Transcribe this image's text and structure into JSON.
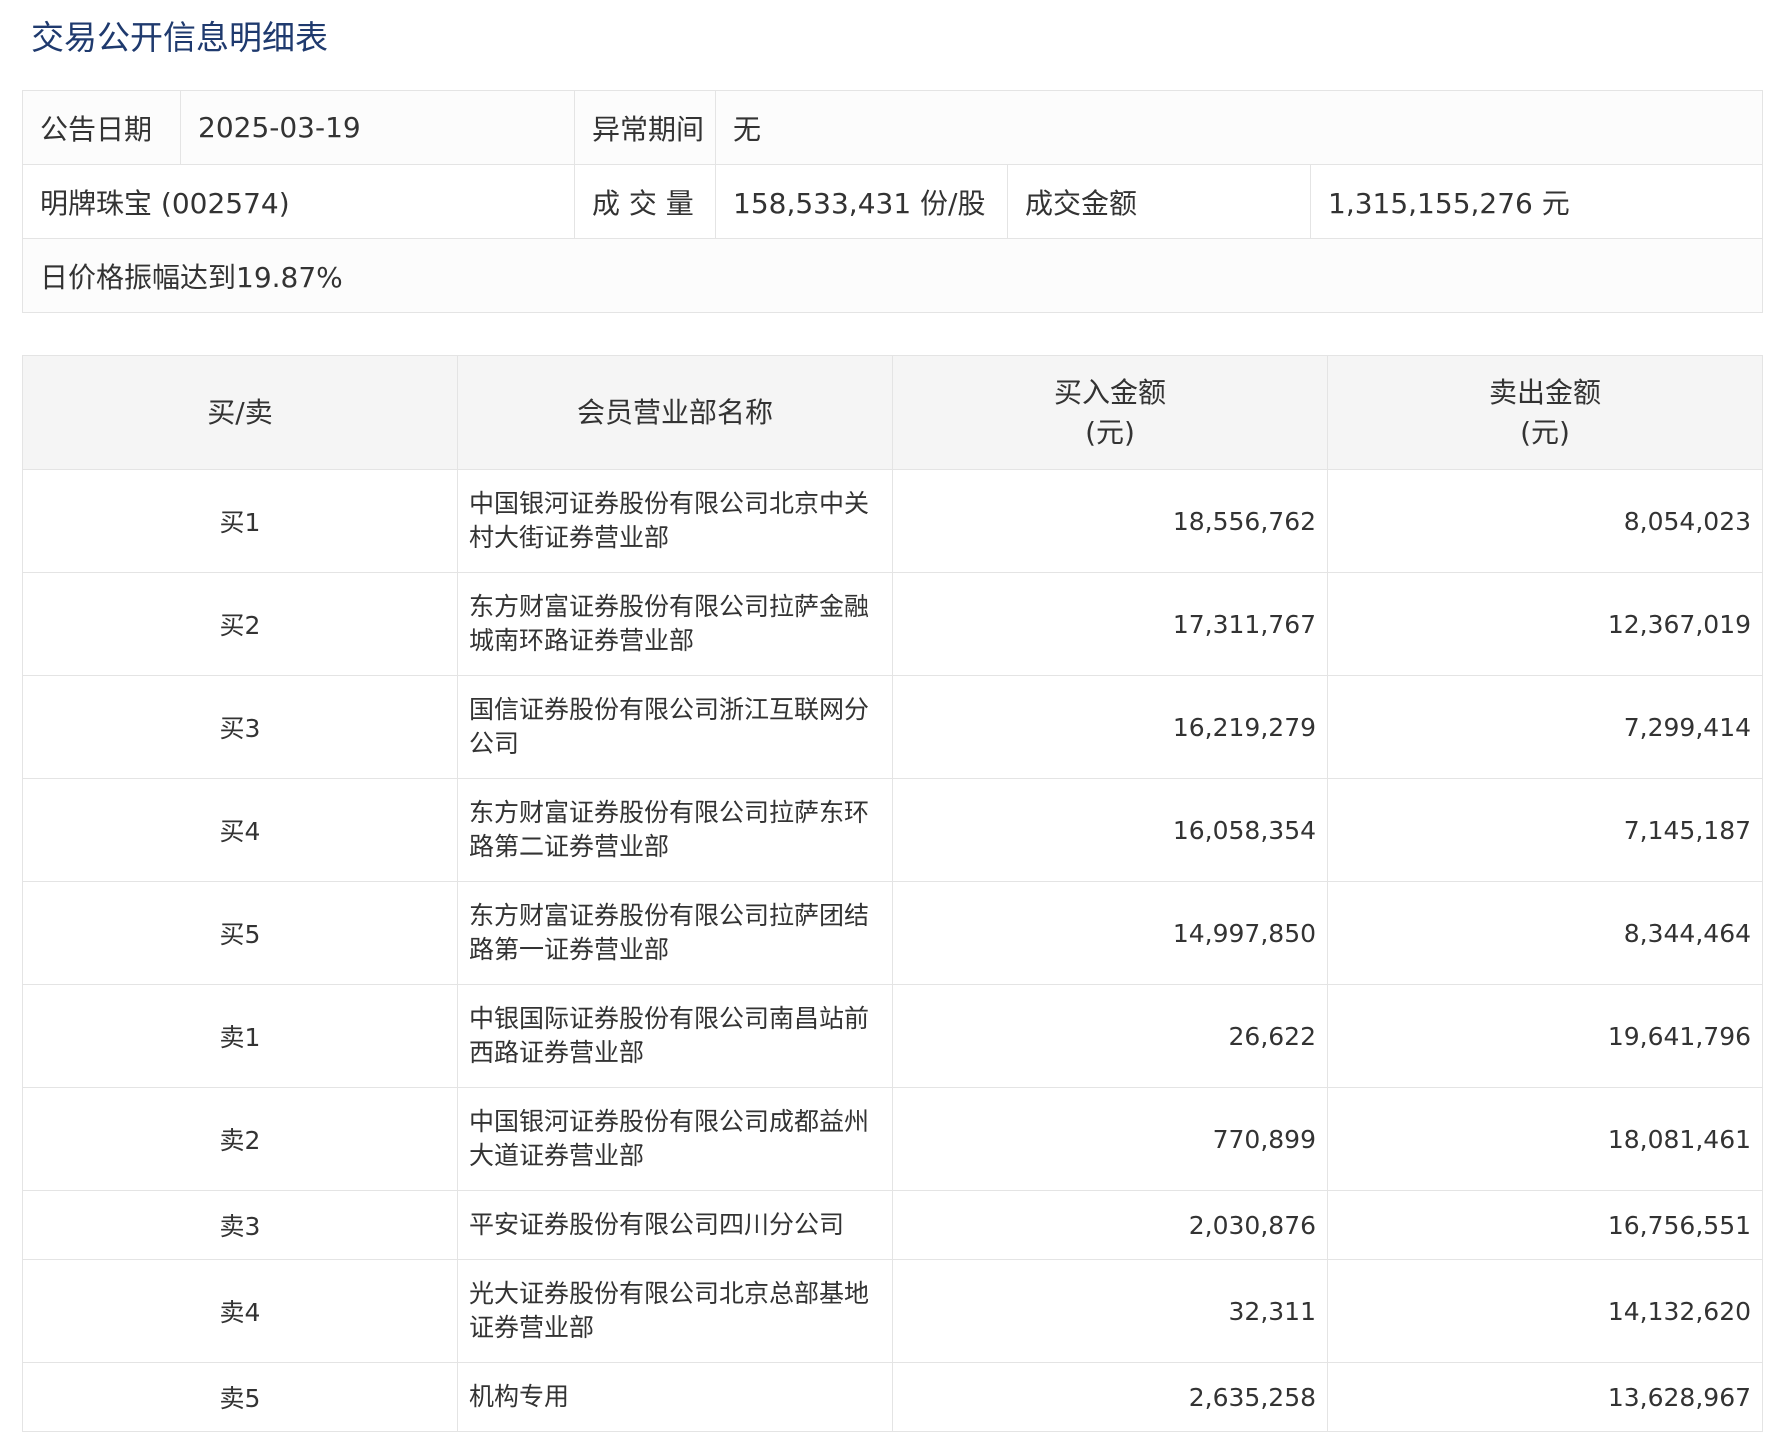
{
  "page": {
    "title": "交易公开信息明细表"
  },
  "info": {
    "announce_date_label": "公告日期",
    "announce_date": "2025-03-19",
    "abnormal_period_label": "异常期间",
    "abnormal_period": "无",
    "stock": "明牌珠宝 (002574)",
    "volume_label": "成 交 量",
    "volume": "158,533,431 份/股",
    "amount_label": "成交金额",
    "amount": "1,315,155,276 元",
    "reason": "日价格振幅达到19.87%"
  },
  "table": {
    "headers": {
      "side": "买/卖",
      "member": "会员营业部名称",
      "buy_line1": "买入金额",
      "buy_line2": "(元)",
      "sell_line1": "卖出金额",
      "sell_line2": "(元)"
    },
    "rows": [
      {
        "side": "买1",
        "name": "中国银河证券股份有限公司北京中关村大街证券营业部",
        "buy": "18,556,762",
        "sell": "8,054,023"
      },
      {
        "side": "买2",
        "name": "东方财富证券股份有限公司拉萨金融城南环路证券营业部",
        "buy": "17,311,767",
        "sell": "12,367,019"
      },
      {
        "side": "买3",
        "name": "国信证券股份有限公司浙江互联网分公司",
        "buy": "16,219,279",
        "sell": "7,299,414"
      },
      {
        "side": "买4",
        "name": "东方财富证券股份有限公司拉萨东环路第二证券营业部",
        "buy": "16,058,354",
        "sell": "7,145,187"
      },
      {
        "side": "买5",
        "name": "东方财富证券股份有限公司拉萨团结路第一证券营业部",
        "buy": "14,997,850",
        "sell": "8,344,464"
      },
      {
        "side": "卖1",
        "name": "中银国际证券股份有限公司南昌站前西路证券营业部",
        "buy": "26,622",
        "sell": "19,641,796"
      },
      {
        "side": "卖2",
        "name": "中国银河证券股份有限公司成都益州大道证券营业部",
        "buy": "770,899",
        "sell": "18,081,461"
      },
      {
        "side": "卖3",
        "name": "平安证券股份有限公司四川分公司",
        "buy": "2,030,876",
        "sell": "16,756,551"
      },
      {
        "side": "卖4",
        "name": "光大证券股份有限公司北京总部基地证券营业部",
        "buy": "32,311",
        "sell": "14,132,620"
      },
      {
        "side": "卖5",
        "name": "机构专用",
        "buy": "2,635,258",
        "sell": "13,628,967"
      }
    ]
  }
}
